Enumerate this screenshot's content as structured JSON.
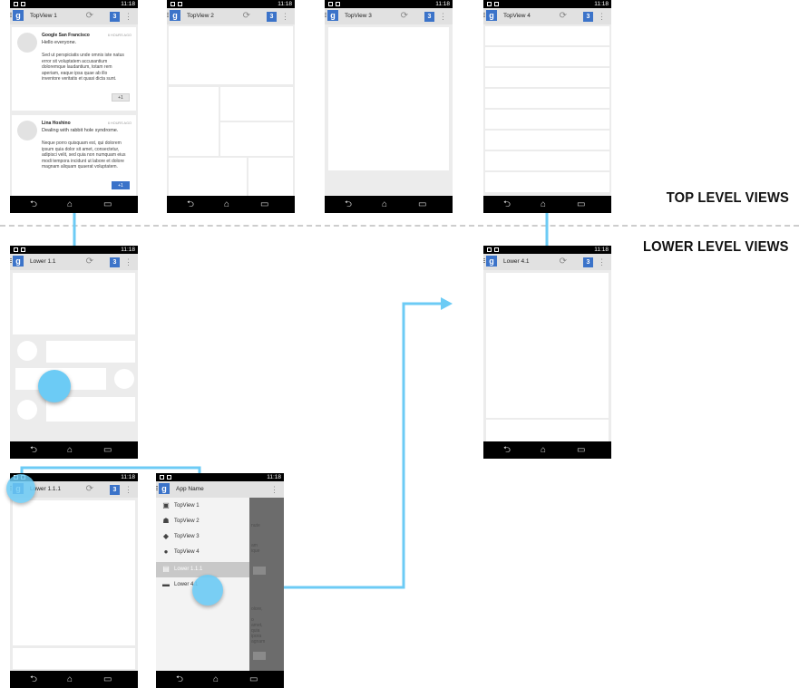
{
  "section_labels": {
    "top": "TOP LEVEL VIEWS",
    "lower": "LOWER LEVEL VIEWS"
  },
  "status_time": "11:18",
  "badge_count": "3",
  "screens": {
    "top1": "TopView 1",
    "top2": "TopView 2",
    "top3": "TopView 3",
    "top4": "TopView 4",
    "lower11": "Lower 1.1",
    "lower111": "Lower 1.1.1",
    "drawer": "App Name",
    "lower41": "Lower 4.1"
  },
  "posts": [
    {
      "author": "Google San Francisco",
      "time": "6 HOURS AGO",
      "subtitle": "Hello everyone.",
      "body": "Sed ut perspiciatis unde omnis iste natus error sit voluptatem accusantium doloremque laudantium, totam rem aperiam, eaque ipsa quae ab illo inventore veritatis et quasi dicta sunt.",
      "plus": "+1"
    },
    {
      "author": "Lina Hoshino",
      "time": "6 HOURS AGO",
      "subtitle": "Dealing with rabbit hole syndrome.",
      "body": "Neque porro quisquam est, qui dolorem ipsum quia dolor sit amet, consectetur, adipisci velit, sed quia non numquam eius modi tempora incidunt ut labore et dolore magnam aliquam quaerat voluptatem.",
      "plus": "+1"
    }
  ],
  "drawer_items": [
    {
      "label": "TopView 1",
      "icon": "inbox-icon"
    },
    {
      "label": "TopView 2",
      "icon": "people-icon"
    },
    {
      "label": "TopView 3",
      "icon": "tag-icon"
    },
    {
      "label": "TopView 4",
      "icon": "info-icon"
    },
    {
      "label": "Lower 1.1.1",
      "icon": "chat-icon",
      "selected": true
    },
    {
      "label": "Lower 4.1",
      "icon": "folder-icon"
    }
  ],
  "colors": {
    "accent": "#6ccbf5",
    "brand": "#3b73c9",
    "statusbar": "#000000"
  }
}
